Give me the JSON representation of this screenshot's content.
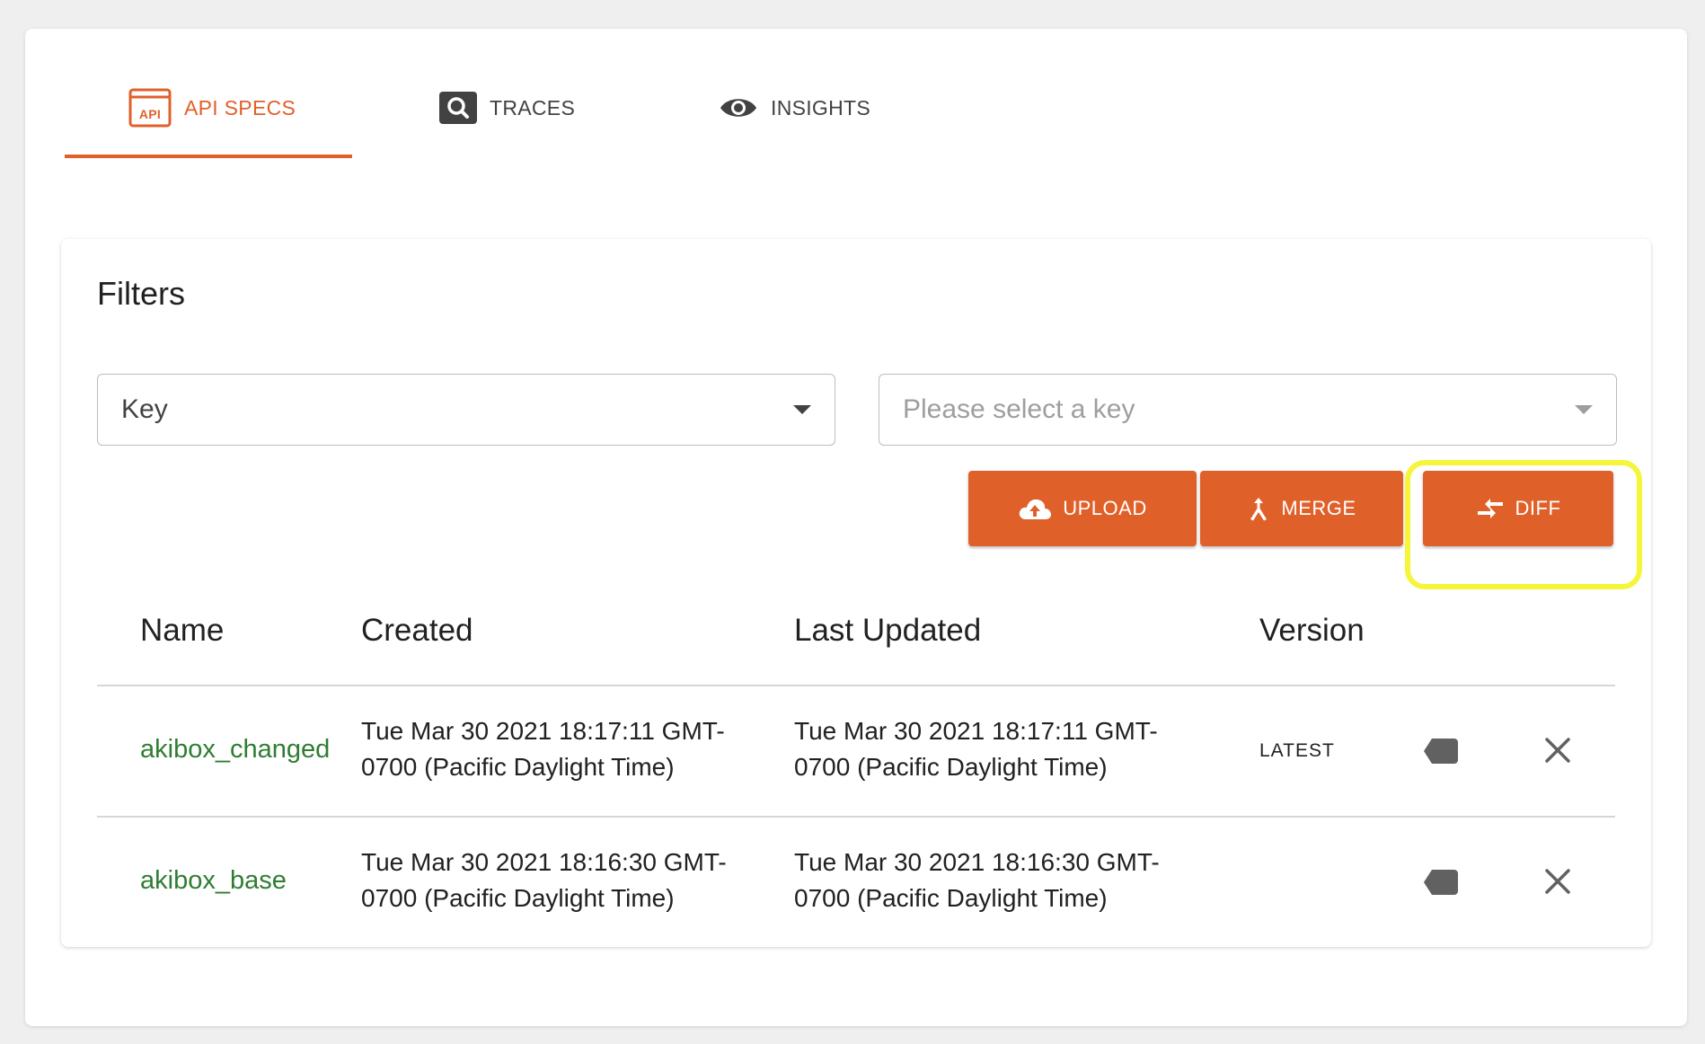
{
  "tabs": [
    {
      "label": "API SPECS",
      "icon": "api-icon",
      "active": true
    },
    {
      "label": "TRACES",
      "icon": "search-icon",
      "active": false
    },
    {
      "label": "INSIGHTS",
      "icon": "eye-icon",
      "active": false
    }
  ],
  "filters": {
    "title": "Filters",
    "key_select": {
      "value": "Key"
    },
    "value_select": {
      "placeholder": "Please select a key"
    }
  },
  "actions": {
    "upload_label": "UPLOAD",
    "merge_label": "MERGE",
    "diff_label": "DIFF"
  },
  "table": {
    "columns": [
      "Name",
      "Created",
      "Last Updated",
      "Version"
    ],
    "rows": [
      {
        "name": "akibox_changed",
        "created_line1": "Tue Mar 30 2021 18:17:11 GMT-",
        "created_line2": "0700 (Pacific Daylight Time)",
        "updated_line1": "Tue Mar 30 2021 18:17:11 GMT-",
        "updated_line2": "0700 (Pacific Daylight Time)",
        "version": "LATEST"
      },
      {
        "name": "akibox_base",
        "created_line1": "Tue Mar 30 2021 18:16:30 GMT-",
        "created_line2": "0700 (Pacific Daylight Time)",
        "updated_line1": "Tue Mar 30 2021 18:16:30 GMT-",
        "updated_line2": "0700 (Pacific Daylight Time)",
        "version": ""
      }
    ]
  },
  "colors": {
    "accent": "#e0602a",
    "link_green": "#2e7d32",
    "highlight": "#f5f53a"
  }
}
